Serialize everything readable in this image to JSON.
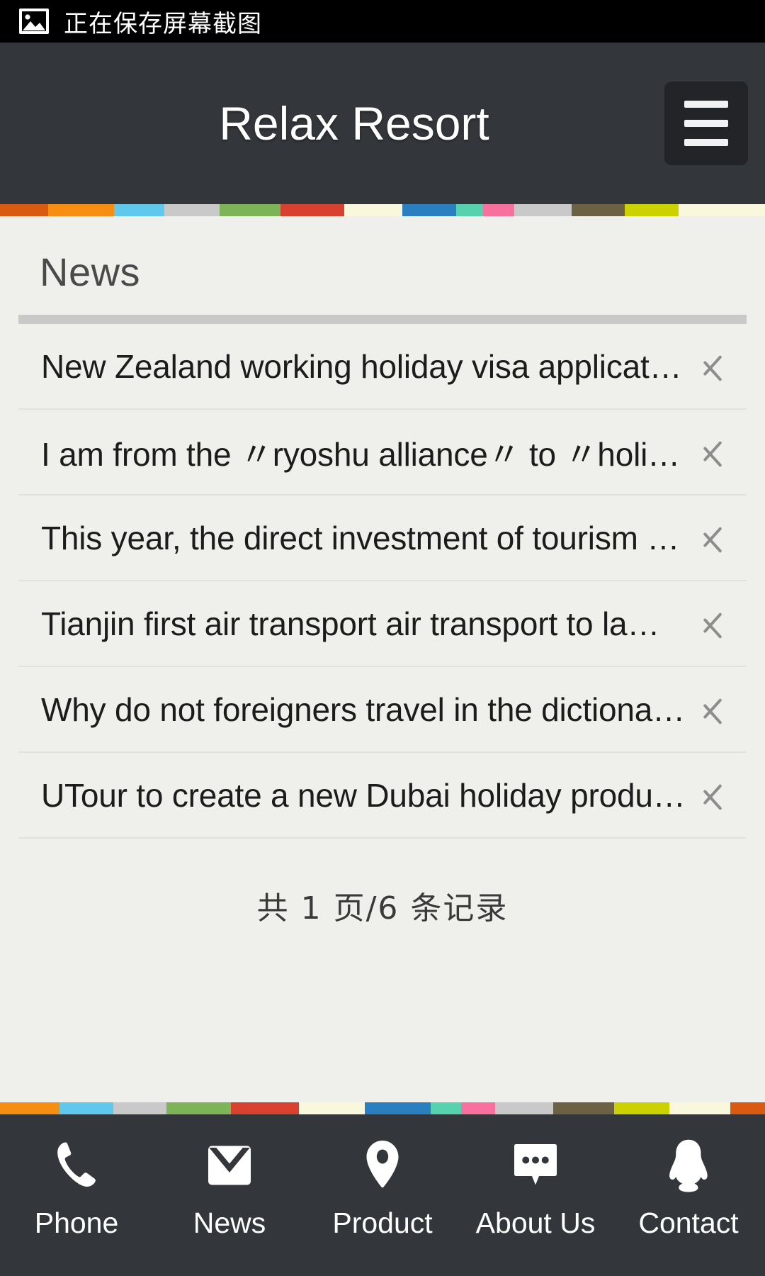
{
  "statusbar": {
    "icon": "image-icon",
    "text": "正在保存屏幕截图"
  },
  "header": {
    "title": "Relax Resort",
    "menu_icon": "hamburger-menu-icon"
  },
  "colors": {
    "header_bg": "#33363a",
    "content_bg": "#eff0eb",
    "status_bg": "#000000",
    "divider": "#c9c9c9",
    "text": "#1c1c1c",
    "chevron": "#8d8d8d"
  },
  "stripe_top": [
    {
      "color": "#d95b12",
      "w": 6.3
    },
    {
      "color": "#f68e12",
      "w": 8.6
    },
    {
      "color": "#5fc8ec",
      "w": 6.6
    },
    {
      "color": "#c9c9c9",
      "w": 7.2
    },
    {
      "color": "#7cb457",
      "w": 8.0
    },
    {
      "color": "#d8412f",
      "w": 8.3
    },
    {
      "color": "#f9f8dc",
      "w": 7.6
    },
    {
      "color": "#2a7fc0",
      "w": 7.0
    },
    {
      "color": "#56d3ae",
      "w": 3.6
    },
    {
      "color": "#f8709e",
      "w": 4.0
    },
    {
      "color": "#c9c9c9",
      "w": 7.5
    },
    {
      "color": "#6c6145",
      "w": 7.0
    },
    {
      "color": "#ccd100",
      "w": 7.0
    },
    {
      "color": "#f9f8dc",
      "w": 11.3
    }
  ],
  "stripe_bottom": [
    {
      "color": "#f68e12",
      "w": 7.8
    },
    {
      "color": "#5fc8ec",
      "w": 7.0
    },
    {
      "color": "#c9c9c9",
      "w": 7.0
    },
    {
      "color": "#7cb457",
      "w": 8.4
    },
    {
      "color": "#d8412f",
      "w": 8.9
    },
    {
      "color": "#f9f8dc",
      "w": 8.6
    },
    {
      "color": "#2a7fc0",
      "w": 8.6
    },
    {
      "color": "#56d3ae",
      "w": 4.0
    },
    {
      "color": "#f8709e",
      "w": 4.4
    },
    {
      "color": "#c9c9c9",
      "w": 7.6
    },
    {
      "color": "#6c6145",
      "w": 8.0
    },
    {
      "color": "#ccd100",
      "w": 7.2
    },
    {
      "color": "#f9f8dc",
      "w": 8.0
    },
    {
      "color": "#d95b12",
      "w": 4.5
    }
  ],
  "main": {
    "section_title": "News",
    "news_items": [
      {
        "title": "New Zealand working holiday visa applicat…",
        "arrow": "chevron-right-icon"
      },
      {
        "title": "I am from the 〃ryoshu alliance〃 to 〃holi…",
        "arrow": "chevron-right-icon"
      },
      {
        "title": "This year, the direct investment of tourism …",
        "arrow": "chevron-right-icon"
      },
      {
        "title": "Tianjin first air transport air transport to la…",
        "arrow": "chevron-right-icon"
      },
      {
        "title": "Why do not foreigners travel in the dictiona…",
        "arrow": "chevron-right-icon"
      },
      {
        "title": "UTour to create a new Dubai holiday produ…",
        "arrow": "chevron-right-icon"
      }
    ],
    "pagination": "共 1 页/6 条记录"
  },
  "footer": {
    "items": [
      {
        "label": "Phone",
        "icon": "phone-icon"
      },
      {
        "label": "News",
        "icon": "envelope-icon"
      },
      {
        "label": "Product",
        "icon": "map-pin-icon"
      },
      {
        "label": "About Us",
        "icon": "chat-bubble-icon"
      },
      {
        "label": "Contact",
        "icon": "qq-penguin-icon"
      }
    ]
  }
}
